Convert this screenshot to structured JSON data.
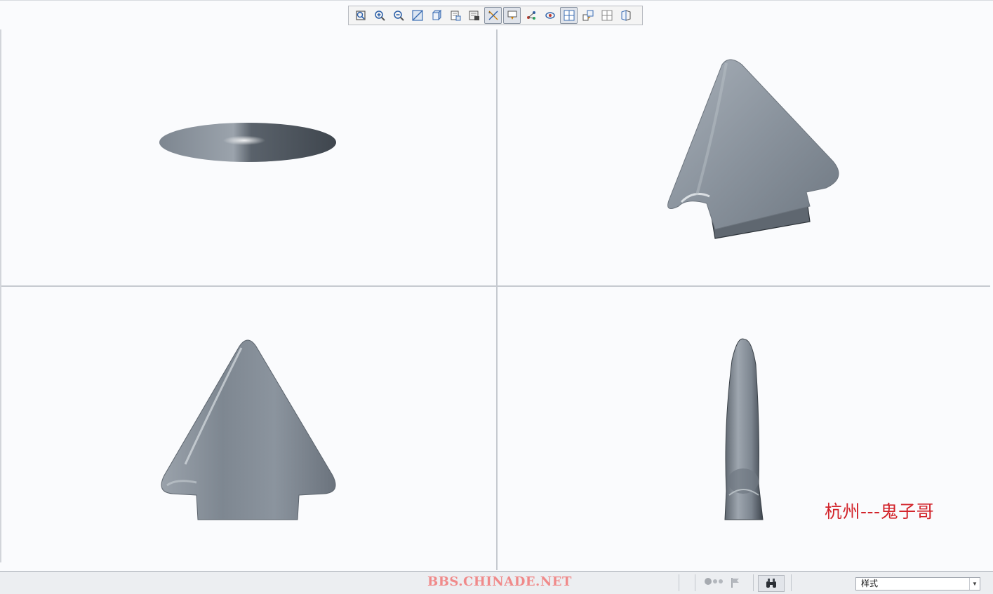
{
  "toolbar": {
    "buttons": [
      {
        "icon": "refit-icon",
        "active": false
      },
      {
        "icon": "zoom-in-icon",
        "active": false
      },
      {
        "icon": "zoom-out-icon",
        "active": false
      },
      {
        "icon": "repaint-icon",
        "active": false
      },
      {
        "icon": "display-style-icon",
        "active": false
      },
      {
        "icon": "saved-views-icon",
        "active": false
      },
      {
        "icon": "view-manager-icon",
        "active": false
      },
      {
        "icon": "datum-display-icon",
        "active": true
      },
      {
        "icon": "annotation-display-icon",
        "active": true
      },
      {
        "icon": "spin-center-icon",
        "active": false
      },
      {
        "icon": "orient-mode-icon",
        "active": false
      },
      {
        "icon": "multi-viewport-icon",
        "active": true
      },
      {
        "icon": "view-normal-icon",
        "active": false
      },
      {
        "icon": "view-split-icon",
        "active": false
      },
      {
        "icon": "section-view-icon",
        "active": false
      }
    ]
  },
  "watermark": {
    "author": "杭州---鬼子哥"
  },
  "statusbar": {
    "site": "BBS.CHINADE.NET",
    "style_select_value": "样式"
  },
  "colors": {
    "model_base": "#8a939d",
    "model_dark": "#4a525b",
    "model_highlight": "#d3d8dd",
    "background": "#fafbfd",
    "watermark_text": "#d2232a",
    "site_text": "#f08a8a"
  }
}
